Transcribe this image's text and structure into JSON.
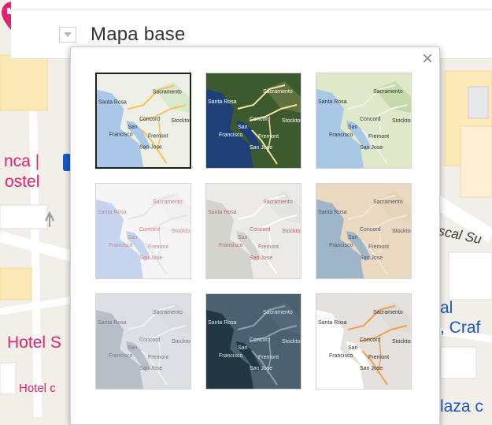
{
  "map": {
    "poi_label_1a": "nca |",
    "poi_label_1b": "ostel",
    "poi_label_2": "Hotel S",
    "poi_label_3": "Hotel c",
    "street_label": "scal Su",
    "place_label_1": "al",
    "place_label_2": ", Craf",
    "place_label_3": "laza c"
  },
  "layer_panel": {
    "title": "Mapa base",
    "toggle_icon": "caret-down-icon"
  },
  "basemap_popup": {
    "close_symbol": "×",
    "thumbnail_labels": {
      "santa_rosa": "Santa Rosa",
      "sacramento": "Sacramento",
      "concord": "Concord",
      "stockton": "Stockton",
      "san_francisco_1": "San",
      "san_francisco_2": "Francisco",
      "fremont": "Fremont",
      "san_jose": "San Jose"
    },
    "styles": [
      {
        "id": "roadmap",
        "selected": true
      },
      {
        "id": "satellite",
        "selected": false
      },
      {
        "id": "terrain",
        "selected": false
      },
      {
        "id": "light-blue",
        "selected": false
      },
      {
        "id": "light-gray",
        "selected": false
      },
      {
        "id": "beige",
        "selected": false
      },
      {
        "id": "muted-gray",
        "selected": false
      },
      {
        "id": "dark",
        "selected": false
      },
      {
        "id": "white-orange",
        "selected": false
      }
    ]
  }
}
